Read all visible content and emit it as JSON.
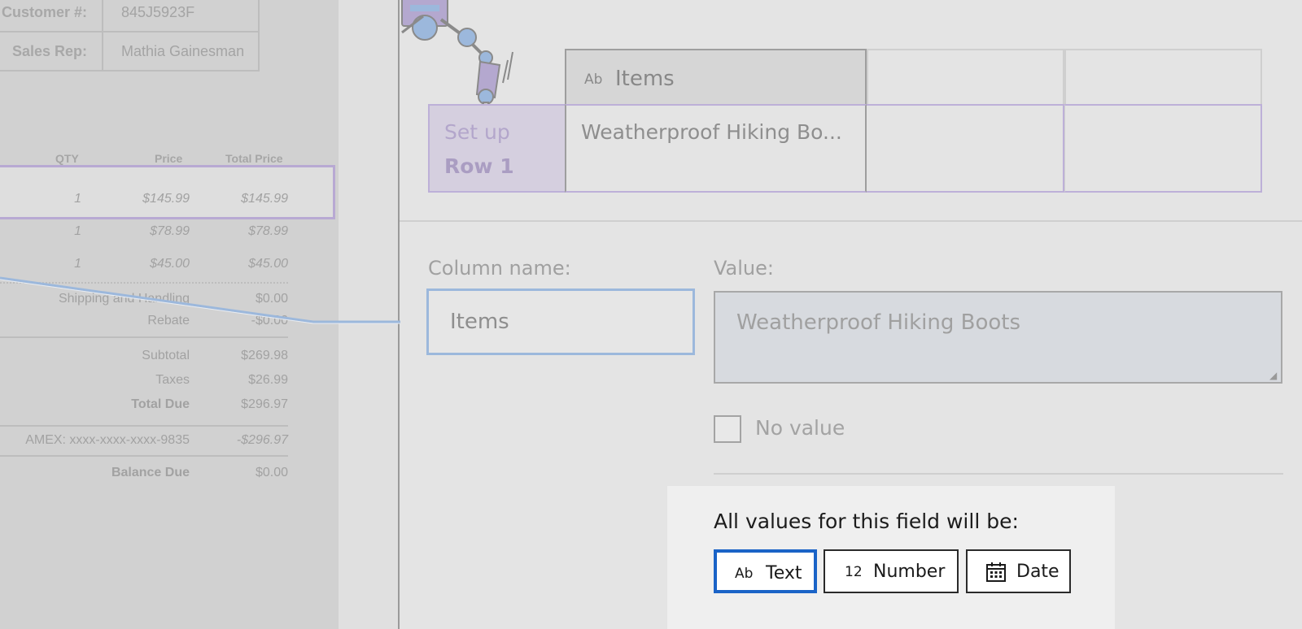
{
  "document": {
    "info_rows": [
      {
        "label": "Customer #:",
        "value": "845J5923F"
      },
      {
        "label": "Sales Rep:",
        "value": "Mathia Gainesman"
      }
    ],
    "columns": {
      "qty": "QTY",
      "price": "Price",
      "total": "Total Price"
    },
    "line_items": [
      {
        "qty": "1",
        "price": "$145.99",
        "total": "$145.99"
      },
      {
        "qty": "1",
        "price": "$78.99",
        "total": "$78.99"
      },
      {
        "qty": "1",
        "price": "$45.00",
        "total": "$45.00"
      }
    ],
    "summary": [
      {
        "label": "Shipping and Handling",
        "value": "$0.00"
      },
      {
        "label": "Rebate",
        "value": "-$0.00"
      },
      {
        "label": "Subtotal",
        "value": "$269.98"
      },
      {
        "label": "Taxes",
        "value": "$26.99"
      },
      {
        "label": "Total Due",
        "value": "$296.97"
      },
      {
        "label": "AMEX: xxxx-xxxx-xxxx-9835",
        "value": "-$296.97"
      },
      {
        "label": "Balance Due",
        "value": "$0.00"
      }
    ]
  },
  "table_preview": {
    "header_icon": "Ab",
    "header_label": "Items",
    "row_label_line1": "Set up",
    "row_label_line2": "Row 1",
    "row_value": "Weatherproof Hiking Bo..."
  },
  "form": {
    "column_name_label": "Column name:",
    "column_name_value": "Items",
    "value_label": "Value:",
    "value_text": "Weatherproof Hiking Boots",
    "no_value_label": "No value",
    "no_value_checked": false
  },
  "type_selector": {
    "prompt": "All values for this field will be:",
    "options": [
      {
        "icon": "Ab",
        "label": "Text",
        "selected": true
      },
      {
        "icon": "12",
        "label": "Number",
        "selected": false
      },
      {
        "icon": "calendar-icon",
        "label": "Date",
        "selected": false
      }
    ]
  },
  "colors": {
    "selected_border": "#1a63c7",
    "row_highlight": "#b8a9d3",
    "input_focus": "#9cb8dc"
  }
}
